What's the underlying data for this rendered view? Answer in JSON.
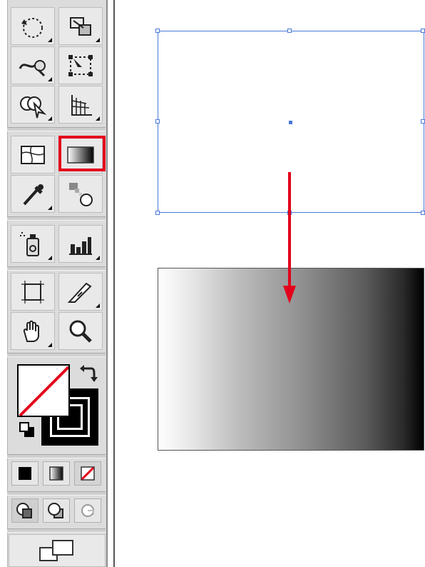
{
  "toolbar": {
    "tools": [
      {
        "name": "rotate-tool",
        "icon": "rotate-icon"
      },
      {
        "name": "scale-tool",
        "icon": "scale-icon"
      },
      {
        "name": "warp-tool",
        "icon": "warp-icon"
      },
      {
        "name": "free-transform-tool",
        "icon": "free-transform-icon"
      },
      {
        "name": "shape-builder-tool",
        "icon": "shape-builder-icon"
      },
      {
        "name": "perspective-grid-tool",
        "icon": "perspective-grid-icon"
      },
      {
        "name": "mesh-tool",
        "icon": "mesh-icon"
      },
      {
        "name": "gradient-tool",
        "icon": "gradient-icon",
        "selected": true
      },
      {
        "name": "eyedropper-tool",
        "icon": "eyedropper-icon"
      },
      {
        "name": "blend-tool",
        "icon": "blend-icon"
      },
      {
        "name": "symbol-sprayer-tool",
        "icon": "symbol-sprayer-icon"
      },
      {
        "name": "column-graph-tool",
        "icon": "column-graph-icon"
      },
      {
        "name": "artboard-tool",
        "icon": "artboard-icon"
      },
      {
        "name": "slice-tool",
        "icon": "slice-icon"
      },
      {
        "name": "hand-tool",
        "icon": "hand-icon"
      },
      {
        "name": "zoom-tool",
        "icon": "zoom-icon"
      }
    ],
    "highlight_color": "#e3001b",
    "fill_color": "none",
    "stroke_color": "#000000",
    "modes": [
      "color-mode-icon",
      "gradient-mode-icon",
      "none-mode-icon"
    ],
    "draw_modes": [
      "draw-normal-icon",
      "draw-behind-icon",
      "draw-inside-icon"
    ],
    "screen_mode": "screen-mode-icon"
  },
  "canvas": {
    "selection_color": "#4a78d8",
    "arrow_color": "#e3001b",
    "gradient": {
      "start": "#ffffff",
      "end": "#000000"
    }
  }
}
